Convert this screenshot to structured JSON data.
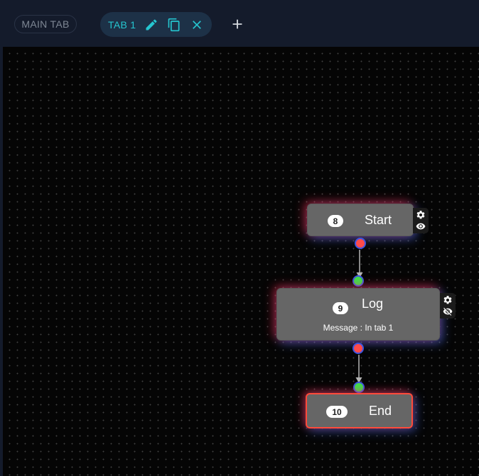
{
  "tabs": {
    "main_label": "MAIN TAB",
    "active_label": "TAB 1",
    "icons": [
      "pencil-icon",
      "copy-icon",
      "close-icon",
      "plus-icon"
    ]
  },
  "colors": {
    "accent": "#25c6d0",
    "canvas_bg": "#050505",
    "node_bg": "#666666",
    "output_port": "#ff4a4a",
    "input_port": "#3ee04a",
    "selected_border": "#ff4a3a"
  },
  "nodes": [
    {
      "id": "8",
      "title": "Start",
      "subtitle": ""
    },
    {
      "id": "9",
      "title": "Log",
      "subtitle": "Message : In tab 1"
    },
    {
      "id": "10",
      "title": "End",
      "subtitle": ""
    }
  ]
}
